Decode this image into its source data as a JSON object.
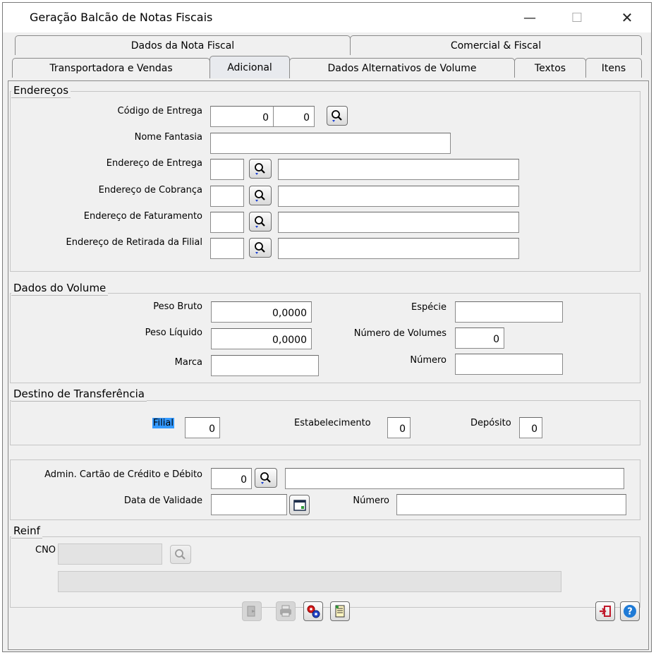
{
  "window": {
    "title": "Geração Balcão de Notas Fiscais",
    "minimize_glyph": "—",
    "maximize_glyph": "☐",
    "close_glyph": "✕"
  },
  "tabs": {
    "row1": [
      "Dados da Nota Fiscal",
      "Comercial & Fiscal"
    ],
    "row2": [
      "Transportadora e Vendas",
      "Adicional",
      "Dados Alternativos de Volume",
      "Textos",
      "Itens"
    ],
    "active": "Adicional"
  },
  "enderecos": {
    "title": "Endereços",
    "codigo_entrega_label": "Código de Entrega",
    "codigo_entrega_value1": "0",
    "codigo_entrega_value2": "0",
    "nome_fantasia_label": "Nome Fantasia",
    "nome_fantasia_value": "",
    "end_entrega_label": "Endereço de Entrega",
    "end_cobranca_label": "Endereço de Cobrança",
    "end_faturamento_label": "Endereço de Faturamento",
    "end_retirada_label": "Endereço de Retirada da Filial"
  },
  "volume": {
    "title": "Dados do Volume",
    "peso_bruto_label": "Peso Bruto",
    "peso_bruto_value": "0,0000",
    "peso_liquido_label": "Peso Líquido",
    "peso_liquido_value": "0,0000",
    "marca_label": "Marca",
    "marca_value": "",
    "especie_label": "Espécie",
    "especie_value": "",
    "num_volumes_label": "Número de Volumes",
    "num_volumes_value": "0",
    "numero_label": "Número",
    "numero_value": ""
  },
  "destino": {
    "title": "Destino de Transferência",
    "filial_label": "Filial",
    "filial_value": "0",
    "estabelecimento_label": "Estabelecimento",
    "estabelecimento_value": "0",
    "deposito_label": "Depósito",
    "deposito_value": "0"
  },
  "cartao": {
    "admin_label": "Admin. Cartão de Crédito e Débito",
    "admin_value": "0",
    "data_validade_label": "Data de Validade",
    "data_validade_value": "",
    "numero_label": "Número",
    "numero_value": ""
  },
  "reinf": {
    "title": "Reinf",
    "cno_label": "CNO",
    "cno_value": ""
  },
  "icons": {
    "lookup": "magnifier-icon",
    "calendar": "calendar-icon",
    "exit": "exit-icon",
    "help": "help-icon"
  },
  "colors": {
    "highlight": "#3399ff",
    "help_blue": "#1e7ad6",
    "exit_red": "#c0182a"
  }
}
